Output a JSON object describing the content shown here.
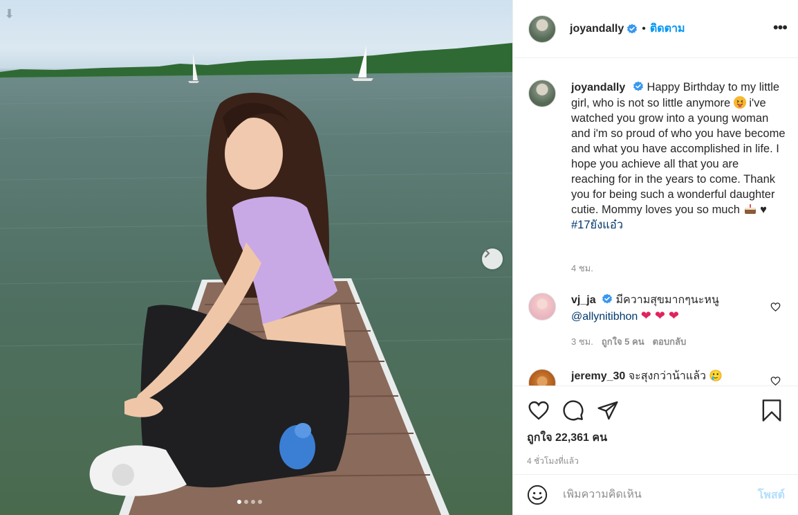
{
  "post": {
    "username": "joyandally",
    "follow_label": "ติดตาม",
    "bullet": "•",
    "more_label": "•••",
    "carousel": {
      "slides": 4,
      "active": 1
    }
  },
  "caption": {
    "username": "joyandally",
    "text_1": "Happy Birthday to my little girl, who is not so little anymore",
    "text_2": "i've watched you grow into a young woman and i'm so proud of who you have become and what you have accomplished in life. I hope you achieve all that you are reaching for in the years to come. Thank you for being such a wonderful daughter cutie. Mommy loves you so much",
    "heart": "♥",
    "hashtag": "#17ยังแอ๋ว",
    "time": "4 ชม."
  },
  "comments": [
    {
      "username": "vj_ja",
      "text": "มีความสุขมากๆนะหนู",
      "mention": "@allynitibhon",
      "hearts": "❤ ❤ ❤",
      "time": "3 ชม.",
      "likes": "ถูกใจ 5 คน",
      "reply": "ตอบกลับ"
    },
    {
      "username": "jeremy_30",
      "text": "จะสุงกว่าน้าแล้ว 🥲"
    }
  ],
  "actions": {
    "like_icon": "heart-icon",
    "comment_icon": "comment-icon",
    "share_icon": "share-icon",
    "save_icon": "bookmark-icon"
  },
  "likes": {
    "label": "ถูกใจ",
    "count": "22,361",
    "unit": "คน"
  },
  "post_time": "4 ชั่วโมงที่แล้ว",
  "add_comment": {
    "placeholder": "เพิ่มความคิดเห็น",
    "post_label": "โพสต์"
  },
  "colors": {
    "link_blue": "#0095f6",
    "hashtag": "#00376b",
    "post_disabled": "#b2dffc",
    "verified": "#3897f0"
  }
}
